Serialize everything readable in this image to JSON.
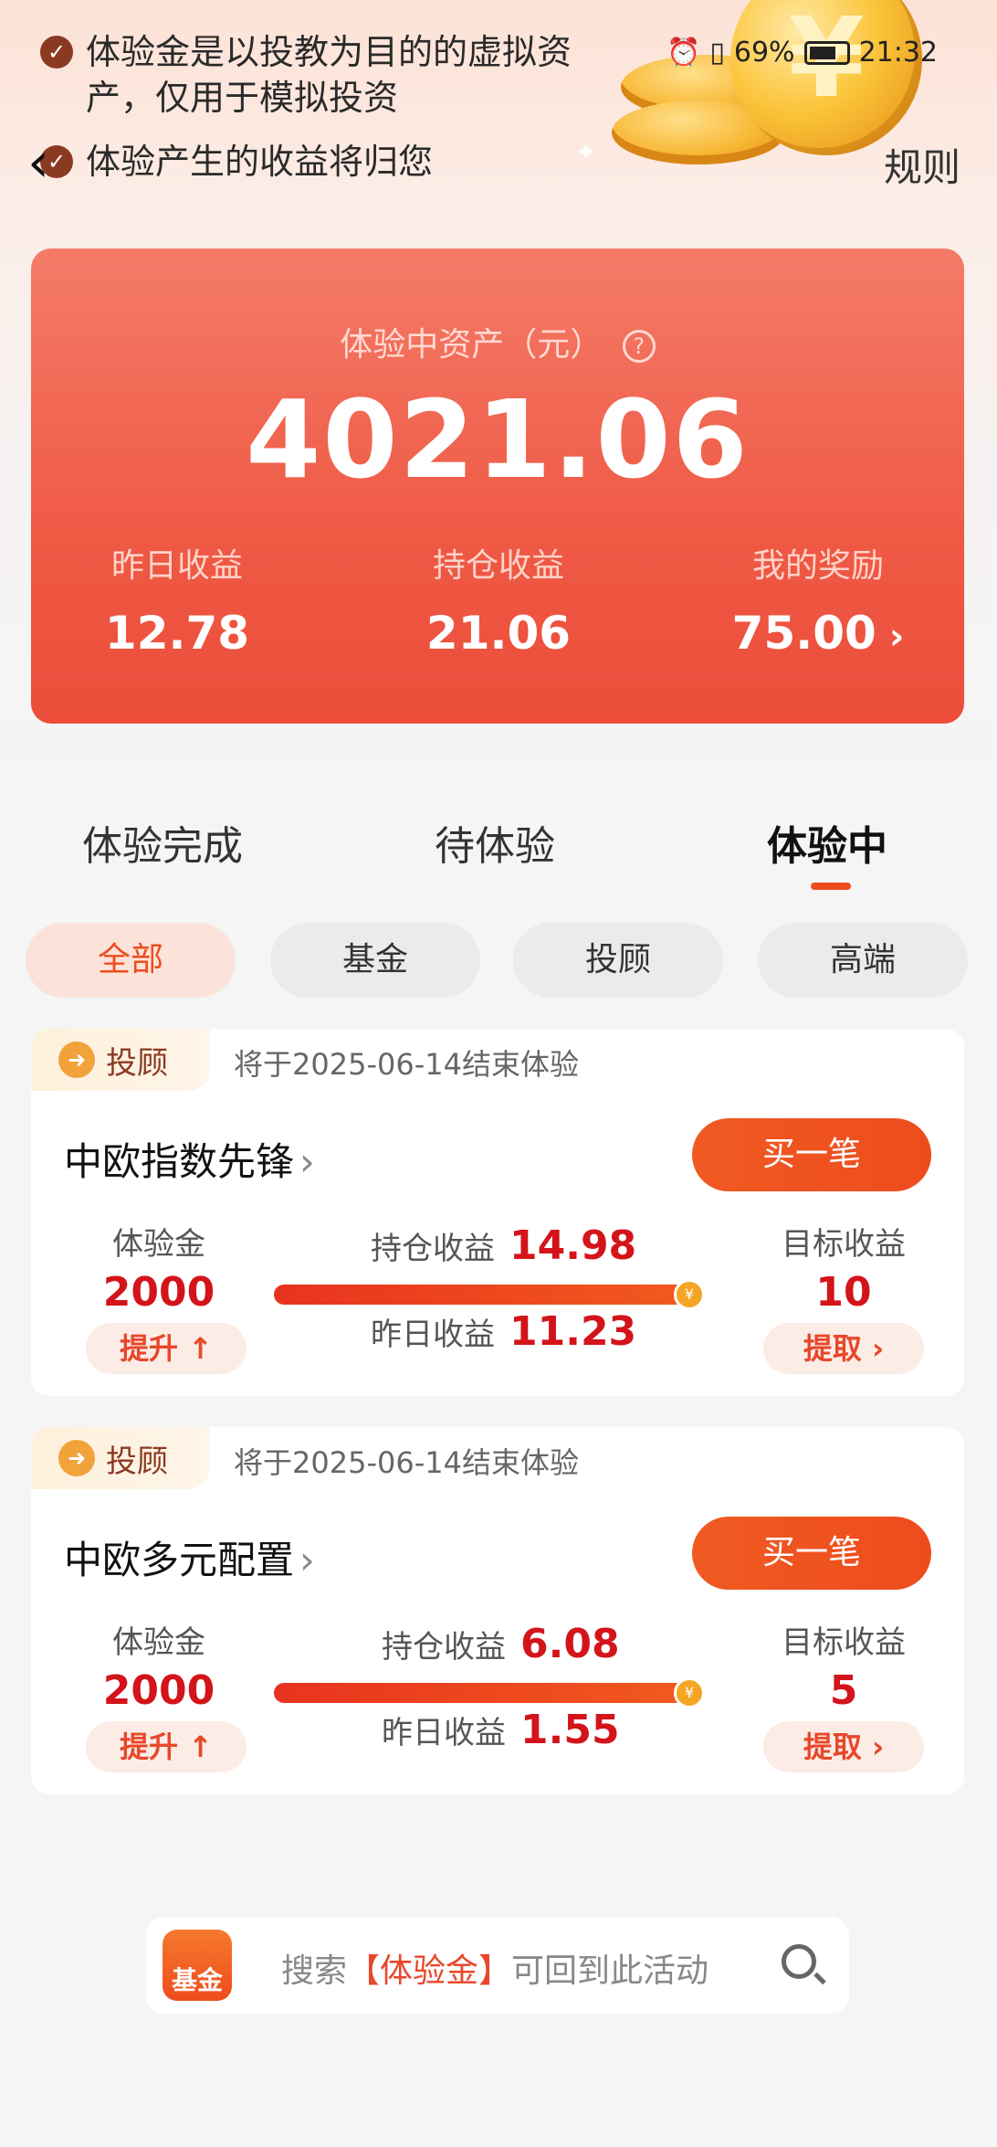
{
  "header": {
    "notes": [
      "体验金是以投教为目的的虚拟资产，仅用于模拟投资",
      "体验产生的收益将归您"
    ],
    "status": {
      "battery": "69%",
      "time": "21:32"
    },
    "rules_label": "规则",
    "coin_symbol": "¥"
  },
  "asset_card": {
    "label": "体验中资产（元）",
    "value": "4021.06",
    "stats": [
      {
        "label": "昨日收益",
        "value": "12.78"
      },
      {
        "label": "持仓收益",
        "value": "21.06"
      },
      {
        "label": "我的奖励",
        "value": "75.00"
      }
    ]
  },
  "tabs": [
    "体验完成",
    "待体验",
    "体验中"
  ],
  "active_tab": "体验中",
  "filters": [
    "全部",
    "基金",
    "投顾",
    "高端"
  ],
  "active_filter": "全部",
  "cards": [
    {
      "badge": "投顾",
      "end_text": "将于2025-06-14结束体验",
      "name": "中欧指数先锋",
      "buy_label": "买一笔",
      "trial_label": "体验金",
      "trial_amount": "2000",
      "upgrade_label": "提升",
      "holding_label": "持仓收益",
      "holding_value": "14.98",
      "yesterday_label": "昨日收益",
      "yesterday_value": "11.23",
      "target_label": "目标收益",
      "target_value": "10",
      "withdraw_label": "提取",
      "progress": 1.0
    },
    {
      "badge": "投顾",
      "end_text": "将于2025-06-14结束体验",
      "name": "中欧多元配置",
      "buy_label": "买一笔",
      "trial_label": "体验金",
      "trial_amount": "2000",
      "upgrade_label": "提升",
      "holding_label": "持仓收益",
      "holding_value": "6.08",
      "yesterday_label": "昨日收益",
      "yesterday_value": "1.55",
      "target_label": "目标收益",
      "target_value": "5",
      "withdraw_label": "提取",
      "progress": 1.0
    }
  ],
  "search": {
    "logo_label": "基金",
    "prefix": "搜索",
    "highlight": "【体验金】",
    "suffix": "可回到此活动"
  },
  "colors": {
    "accent": "#ee4c1c",
    "red_text": "#d3141a",
    "card_gradient_top": "#f47b68"
  }
}
